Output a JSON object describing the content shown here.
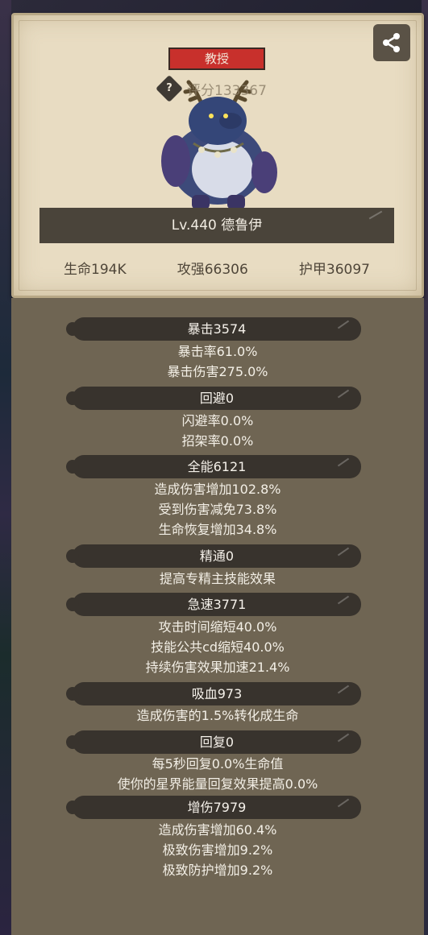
{
  "character": {
    "title_badge": "教授",
    "score_label": "评分133367",
    "level_name": "Lv.440 德鲁伊",
    "core_stats": [
      {
        "label": "生命194K"
      },
      {
        "label": "攻强66306"
      },
      {
        "label": "护甲36097"
      }
    ]
  },
  "stat_groups": [
    {
      "header": "暴击3574",
      "lines": [
        "暴击率61.0%",
        "暴击伤害275.0%"
      ]
    },
    {
      "header": "回避0",
      "lines": [
        "闪避率0.0%",
        "招架率0.0%"
      ]
    },
    {
      "header": "全能6121",
      "lines": [
        "造成伤害增加102.8%",
        "受到伤害减免73.8%",
        "生命恢复增加34.8%"
      ]
    },
    {
      "header": "精通0",
      "lines": [
        "提高专精主技能效果"
      ]
    },
    {
      "header": "急速3771",
      "lines": [
        "攻击时间缩短40.0%",
        "技能公共cd缩短40.0%",
        "持续伤害效果加速21.4%"
      ]
    },
    {
      "header": "吸血973",
      "lines": [
        "造成伤害的1.5%转化成生命"
      ]
    },
    {
      "header": "回复0",
      "lines": [
        "每5秒回复0.0%生命值",
        "使你的星界能量回复效果提高0.0%"
      ]
    },
    {
      "header": "增伤7979",
      "lines": [
        "造成伤害增加60.4%",
        "极致伤害增加9.2%",
        "极致防护增加9.2%"
      ]
    }
  ],
  "icons": {
    "share": "share-icon",
    "help": "question-icon"
  },
  "colors": {
    "badge_red": "#c8302c",
    "card_bg": "#e8dcc2",
    "panel_bg": "#6f6553",
    "header_bg": "#38332d"
  }
}
